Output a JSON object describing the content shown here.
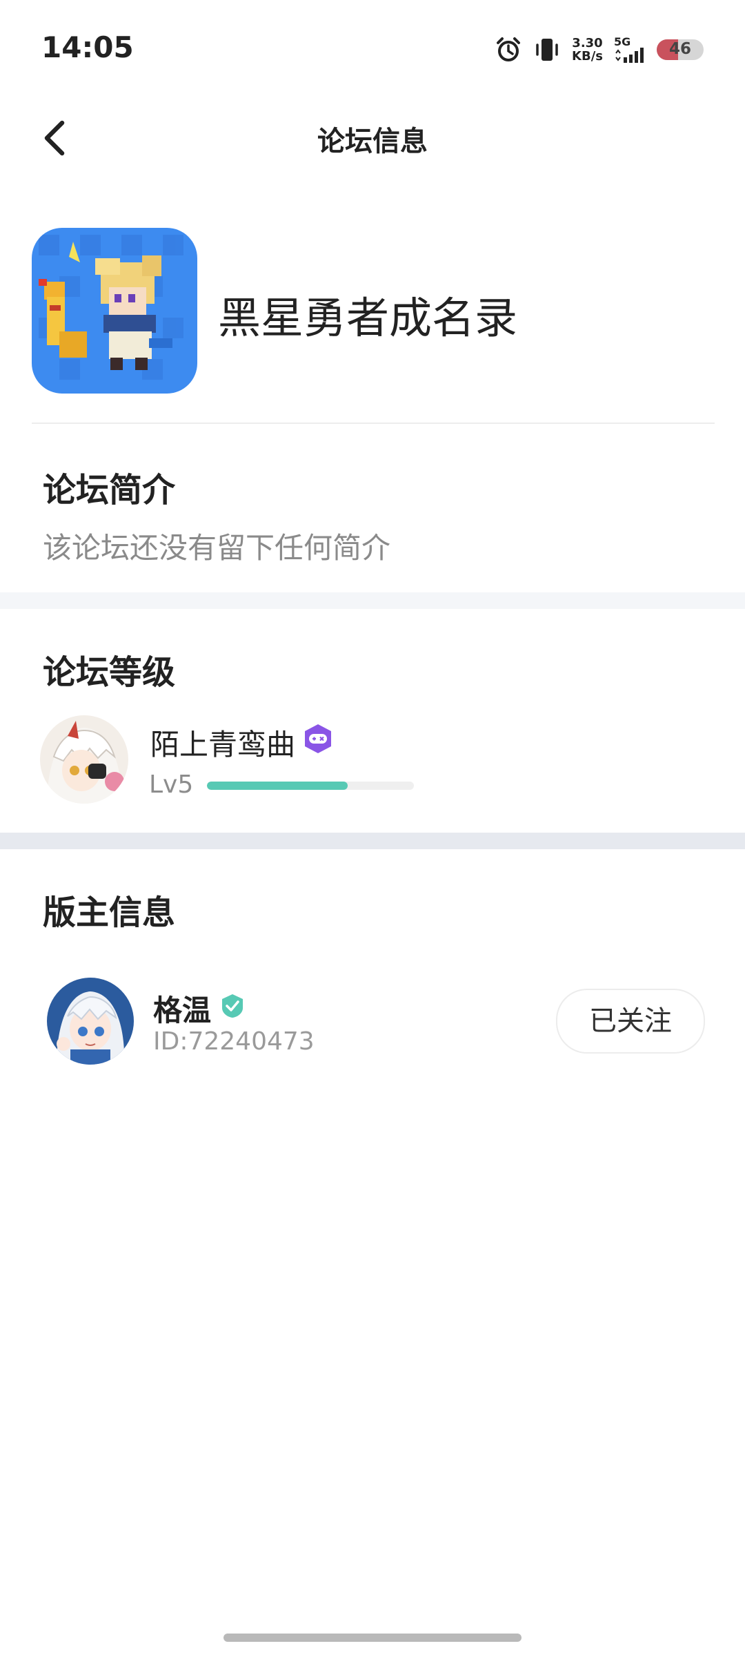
{
  "status_bar": {
    "time": "14:05",
    "net_speed_value": "3.30",
    "net_speed_unit": "KB/s",
    "network_type": "5G",
    "battery_level": "46",
    "battery_color": "#c9525d"
  },
  "header": {
    "title": "论坛信息",
    "back_icon": "chevron-left-icon"
  },
  "forum": {
    "name": "黑星勇者成名录",
    "icon_bg": "#3d8bf0"
  },
  "intro": {
    "title": "论坛简介",
    "text": "该论坛还没有留下任何简介"
  },
  "level": {
    "title": "论坛等级",
    "user_name": "陌上青鸾曲",
    "badge_icon": "gamepad-badge-icon",
    "badge_color": "#8a55e6",
    "level_label": "Lv5",
    "progress": 0.68,
    "progress_color": "#57c9b4"
  },
  "moderator": {
    "title": "版主信息",
    "name": "格温",
    "verified_icon": "verified-check-icon",
    "verified_color": "#57c9b4",
    "id_text": "ID:72240473",
    "follow_label": "已关注"
  },
  "colors": {
    "band": "#f4f6f9",
    "band_dark": "#e6e9ef"
  }
}
